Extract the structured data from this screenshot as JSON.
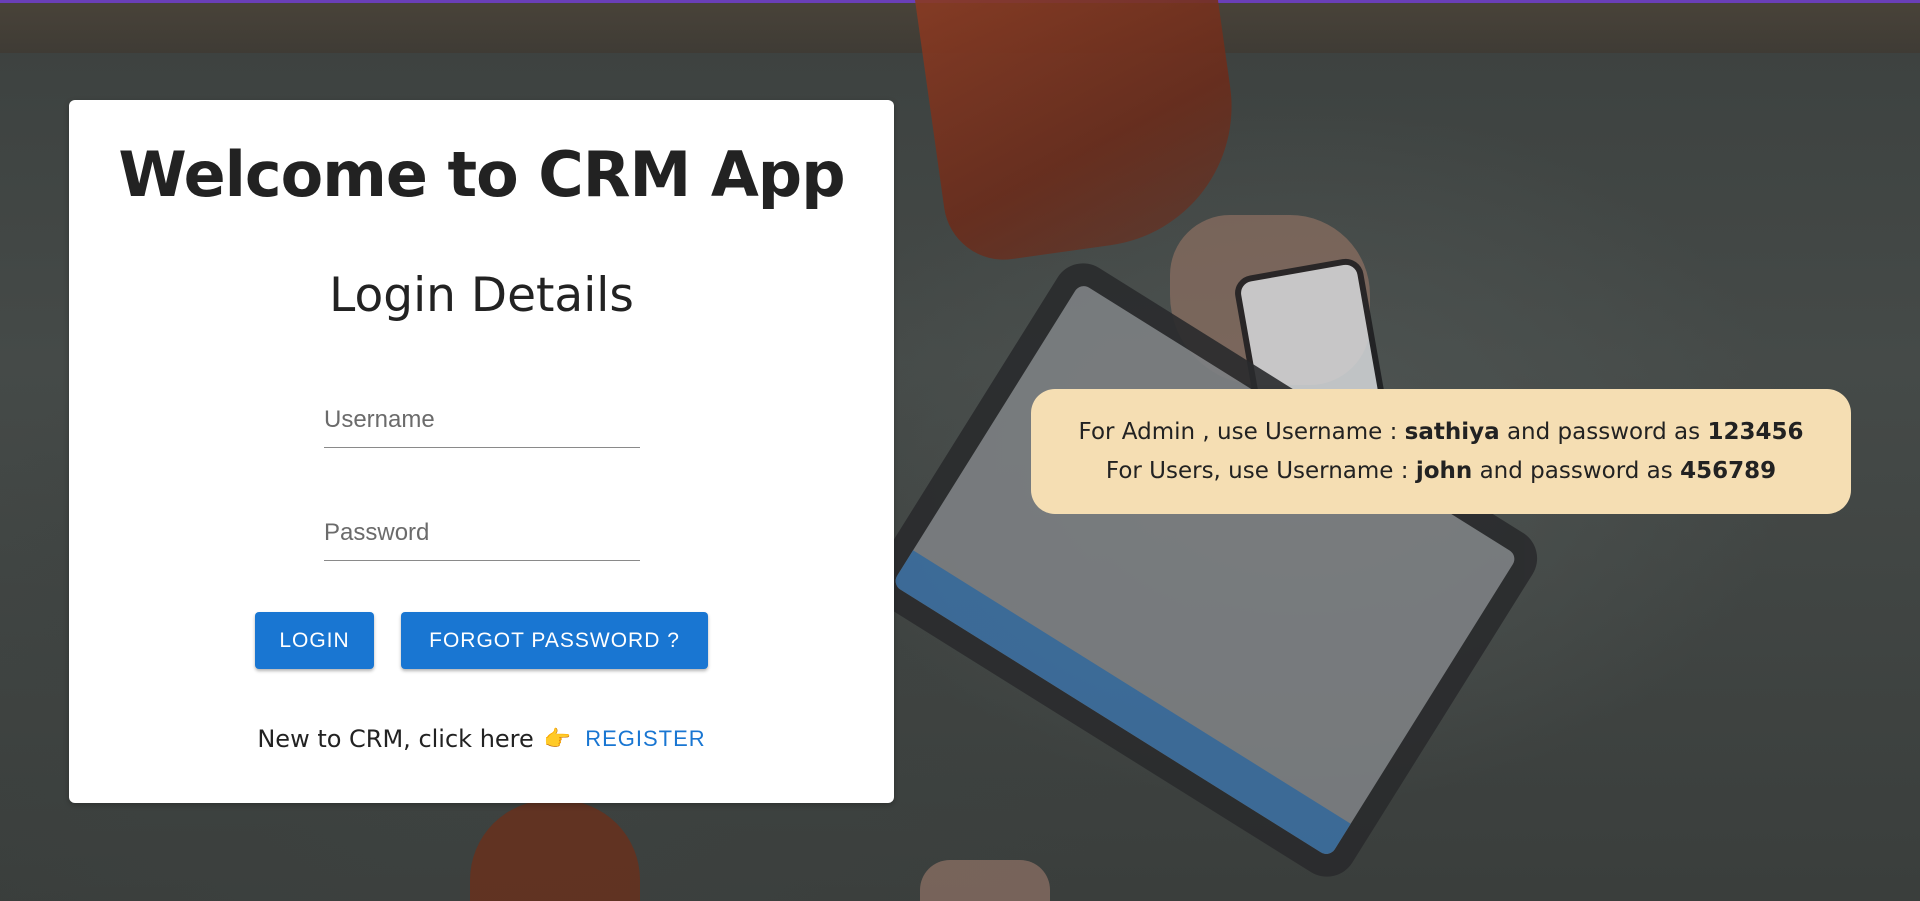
{
  "app": {
    "title": "Welcome to CRM App",
    "subtitle": "Login Details"
  },
  "login_form": {
    "username_placeholder": "Username",
    "username_value": "",
    "password_placeholder": "Password",
    "password_value": "",
    "login_label": "LOGIN",
    "forgot_label": "FORGOT PASSWORD ?"
  },
  "register": {
    "prompt": "New to CRM, click here",
    "icon": "backhand-index-pointing-right-icon",
    "link_label": "REGISTER"
  },
  "credentials_note": {
    "admin": {
      "prefix": "For Admin , use Username : ",
      "username": "sathiya",
      "middle": " and password as ",
      "password": "123456"
    },
    "users": {
      "prefix": "For Users, use Username : ",
      "username": "john",
      "middle": " and password as ",
      "password": "456789"
    }
  },
  "colors": {
    "primary": "#1976d2",
    "note_background": "#f5deb3",
    "top_strip": "#6a3fb8"
  }
}
